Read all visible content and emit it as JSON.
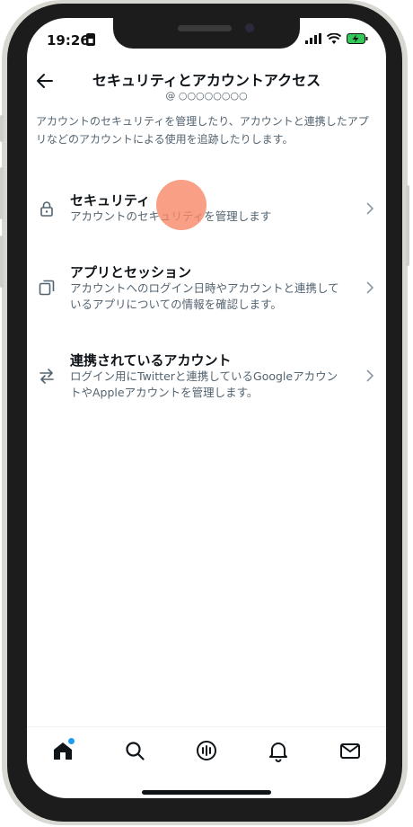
{
  "status": {
    "time": "19:26"
  },
  "header": {
    "title": "セキュリティとアカウントアクセス",
    "subtitle": "@ ○○○○○○○○"
  },
  "description": "アカウントのセキュリティを管理したり、アカウントと連携したアプリなどのアカウントによる使用を追跡したりします。",
  "items": [
    {
      "title": "セキュリティ",
      "desc": "アカウントのセキュリティを管理します"
    },
    {
      "title": "アプリとセッション",
      "desc": "アカウントへのログイン日時やアカウントと連携しているアプリについての情報を確認します。"
    },
    {
      "title": "連携されているアカウント",
      "desc": "ログイン用にTwitterと連携しているGoogleアカウントやAppleアカウントを管理します。"
    }
  ],
  "tabs": [
    "home-icon",
    "search-icon",
    "spaces-icon",
    "notifications-icon",
    "messages-icon"
  ],
  "colors": {
    "accent": "#1d9bf0",
    "text": "#0f1419",
    "secondary": "#536471",
    "touch": "#f78766"
  }
}
